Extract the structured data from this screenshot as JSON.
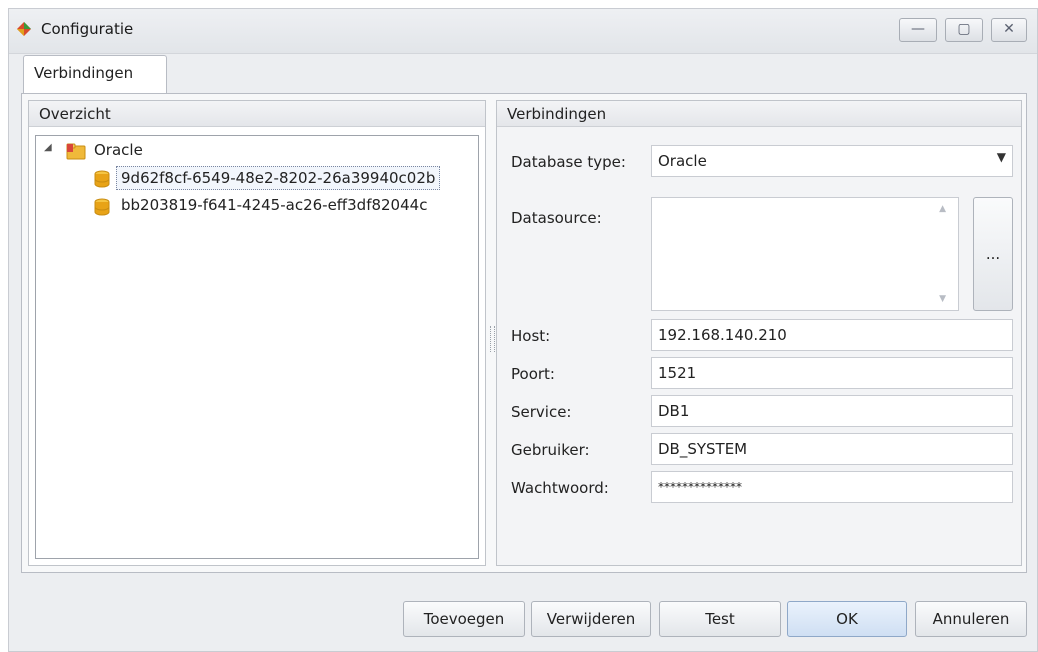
{
  "window": {
    "title": "Configuratie",
    "controls": {
      "minimize": "—",
      "maximize": "▢",
      "close": "✕"
    }
  },
  "tabs": [
    {
      "label": "Verbindingen",
      "active": true
    }
  ],
  "overview": {
    "header": "Overzicht",
    "tree": {
      "root_label": "Oracle",
      "children": [
        {
          "label": "9d62f8cf-6549-48e2-8202-26a39940c02b",
          "selected": true
        },
        {
          "label": "bb203819-f641-4245-ac26-eff3df82044c",
          "selected": false
        }
      ]
    }
  },
  "connection": {
    "header": "Verbindingen",
    "database_type_label": "Database type:",
    "database_type_value": "Oracle",
    "datasource_label": "Datasource:",
    "datasource_value": "",
    "browse_label": "...",
    "host_label": "Host:",
    "host_value": "192.168.140.210",
    "port_label": "Poort:",
    "port_value": "1521",
    "service_label": "Service:",
    "service_value": "DB1",
    "user_label": "Gebruiker:",
    "user_value": "DB_SYSTEM",
    "password_label": "Wachtwoord:",
    "password_value": "**************"
  },
  "footer": {
    "add": "Toevoegen",
    "remove": "Verwijderen",
    "test": "Test",
    "ok": "OK",
    "cancel": "Annuleren"
  },
  "colors": {
    "accent_ok": "#cfdff3",
    "window_bg": "#eceef1",
    "icon_db": "#e8a317",
    "icon_folder": "#f0b93a"
  }
}
